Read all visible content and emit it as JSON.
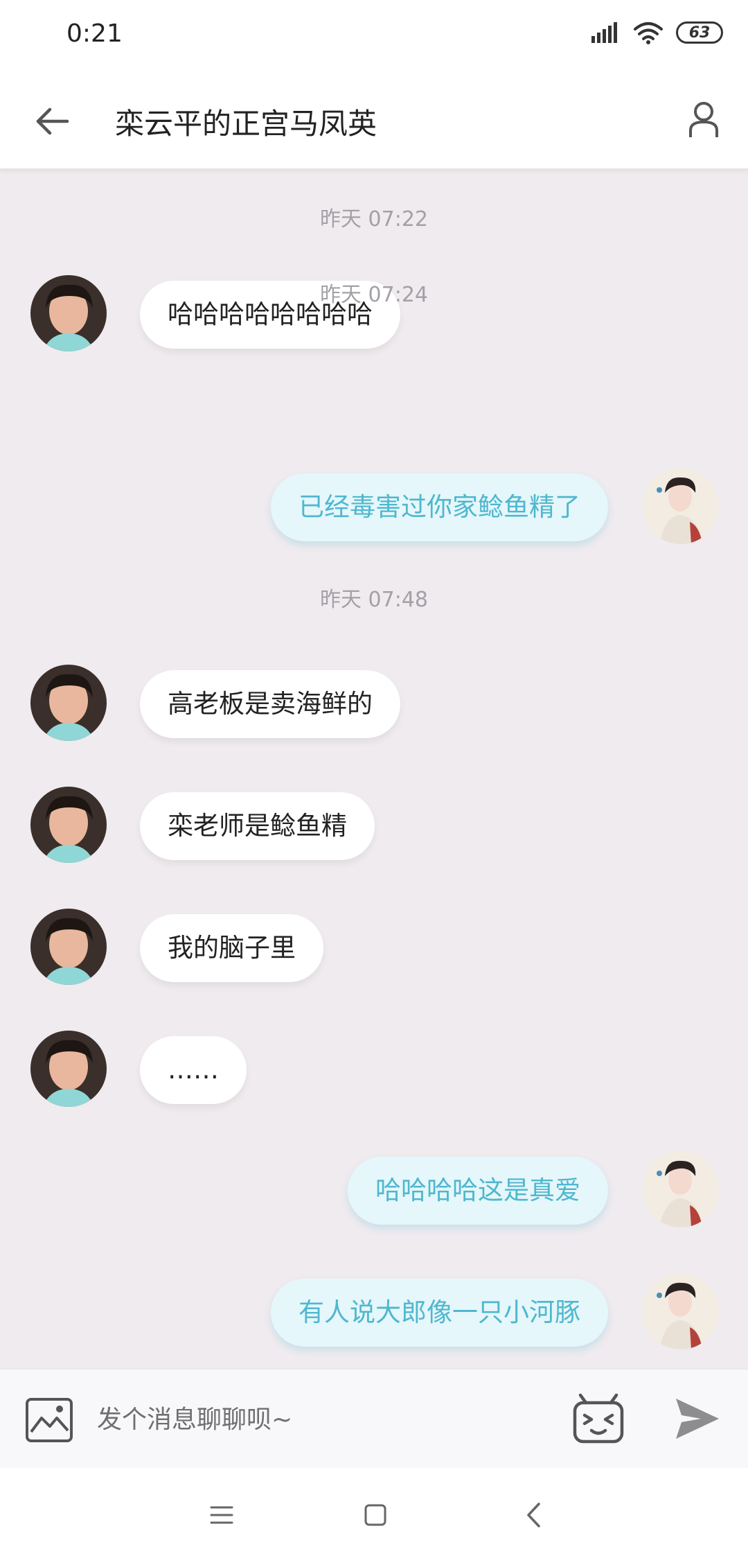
{
  "status_bar": {
    "time": "0:21",
    "battery": "63"
  },
  "header": {
    "title": "栾云平的正宫马凤英"
  },
  "messages": [
    {
      "type": "time",
      "text": "昨天 07:22"
    },
    {
      "type": "msg",
      "side": "left",
      "text": "哈哈哈哈哈哈哈哈"
    },
    {
      "type": "time",
      "text": "昨天 07:24"
    },
    {
      "type": "msg",
      "side": "right",
      "text": "已经毒害过你家鲶鱼精了"
    },
    {
      "type": "time",
      "text": "昨天 07:48"
    },
    {
      "type": "msg",
      "side": "left",
      "text": "高老板是卖海鲜的"
    },
    {
      "type": "msg",
      "side": "left",
      "text": "栾老师是鲶鱼精"
    },
    {
      "type": "msg",
      "side": "left",
      "text": "我的脑子里"
    },
    {
      "type": "msg",
      "side": "left",
      "text": "……"
    },
    {
      "type": "msg",
      "side": "right",
      "text": "哈哈哈哈这是真爱"
    },
    {
      "type": "msg",
      "side": "right",
      "text": "有人说大郎像一只小河豚"
    }
  ],
  "input": {
    "placeholder": "发个消息聊聊呗~",
    "value": ""
  },
  "colors": {
    "background": "#efebef",
    "outgoing_bubble": "#e5f7fa",
    "outgoing_text": "#4fb7cf",
    "incoming_bubble": "#ffffff"
  },
  "icons": {
    "image": "image-icon",
    "emoji": "tv-emoji-icon",
    "send": "send-icon"
  }
}
